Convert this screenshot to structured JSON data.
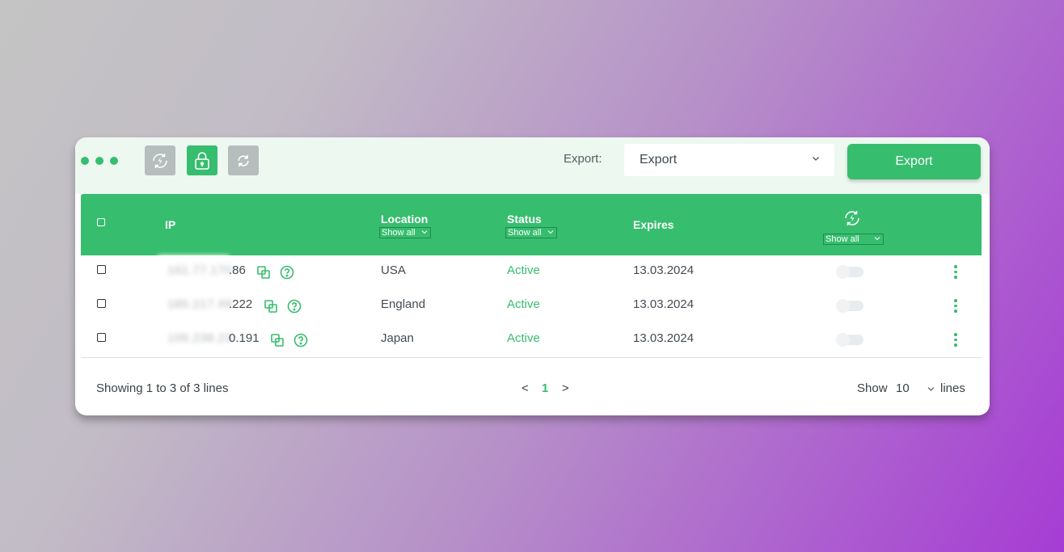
{
  "toolbar": {
    "export_label": "Export:",
    "export_select_value": "Export",
    "export_button": "Export"
  },
  "table": {
    "columns": {
      "ip": "IP",
      "location": "Location",
      "status": "Status",
      "expires": "Expires"
    },
    "filters": {
      "location": "Show all",
      "status": "Show all",
      "rotation": "Show all"
    },
    "rows": [
      {
        "ip_visible": ".86",
        "ip_hidden": "161.77.170",
        "location": "USA",
        "status": "Active",
        "expires": "13.03.2024"
      },
      {
        "ip_visible": ".222",
        "ip_hidden": "185.217.49",
        "location": "England",
        "status": "Active",
        "expires": "13.03.2024"
      },
      {
        "ip_visible": "0.191",
        "ip_hidden": "109.238.23",
        "location": "Japan",
        "status": "Active",
        "expires": "13.03.2024"
      }
    ]
  },
  "footer": {
    "showing": "Showing 1 to 3 of 3 lines",
    "prev": "<",
    "page": "1",
    "next": ">",
    "show_label": "Show",
    "per_page": "10",
    "lines_label": "lines"
  },
  "colors": {
    "accent": "#37bd6e",
    "toolbar_bg": "#edf8f0",
    "gray_button": "#b5bdbd"
  }
}
